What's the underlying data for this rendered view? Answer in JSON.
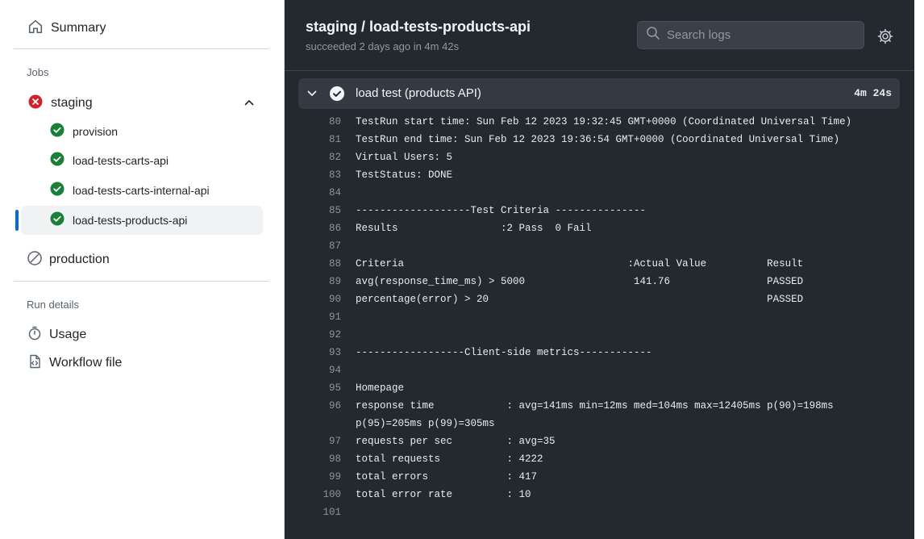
{
  "sidebar": {
    "summary_label": "Summary",
    "jobs_heading": "Jobs",
    "workflow_group": {
      "label": "staging",
      "status": "failed"
    },
    "jobs": [
      {
        "label": "provision",
        "status": "success"
      },
      {
        "label": "load-tests-carts-api",
        "status": "success"
      },
      {
        "label": "load-tests-carts-internal-api",
        "status": "success"
      },
      {
        "label": "load-tests-products-api",
        "status": "success",
        "active": true
      }
    ],
    "production_label": "production",
    "run_details_heading": "Run details",
    "usage_label": "Usage",
    "workflow_file_label": "Workflow file"
  },
  "header": {
    "title": "staging / load-tests-products-api",
    "subtitle": "succeeded 2 days ago in 4m 42s",
    "search_placeholder": "Search logs"
  },
  "step": {
    "name": "load test (products API)",
    "duration": "4m 24s"
  },
  "log_lines": [
    {
      "n": "80",
      "t": "TestRun start time: Sun Feb 12 2023 19:32:45 GMT+0000 (Coordinated Universal Time)"
    },
    {
      "n": "81",
      "t": "TestRun end time: Sun Feb 12 2023 19:36:54 GMT+0000 (Coordinated Universal Time)"
    },
    {
      "n": "82",
      "t": "Virtual Users: 5"
    },
    {
      "n": "83",
      "t": "TestStatus: DONE"
    },
    {
      "n": "84",
      "t": ""
    },
    {
      "n": "85",
      "t": "-------------------Test Criteria ---------------"
    },
    {
      "n": "86",
      "t": "Results                 :2 Pass  0 Fail"
    },
    {
      "n": "87",
      "t": ""
    },
    {
      "n": "88",
      "t": "Criteria                                     :Actual Value          Result"
    },
    {
      "n": "89",
      "t": "avg(response_time_ms) > 5000                  141.76                PASSED"
    },
    {
      "n": "90",
      "t": "percentage(error) > 20                                              PASSED"
    },
    {
      "n": "91",
      "t": ""
    },
    {
      "n": "92",
      "t": ""
    },
    {
      "n": "93",
      "t": "------------------Client-side metrics------------"
    },
    {
      "n": "94",
      "t": ""
    },
    {
      "n": "95",
      "t": "Homepage"
    },
    {
      "n": "96",
      "t": "response time            : avg=141ms min=12ms med=104ms max=12405ms p(90)=198ms p(95)=205ms p(99)=305ms"
    },
    {
      "n": "97",
      "t": "requests per sec         : avg=35"
    },
    {
      "n": "98",
      "t": "total requests           : 4222"
    },
    {
      "n": "99",
      "t": "total errors             : 417"
    },
    {
      "n": "100",
      "t": "total error rate         : 10"
    },
    {
      "n": "101",
      "t": ""
    }
  ],
  "colors": {
    "success": "#1a7f37",
    "failure": "#cf222e",
    "accent": "#0969da",
    "log_bg": "#24292f"
  }
}
